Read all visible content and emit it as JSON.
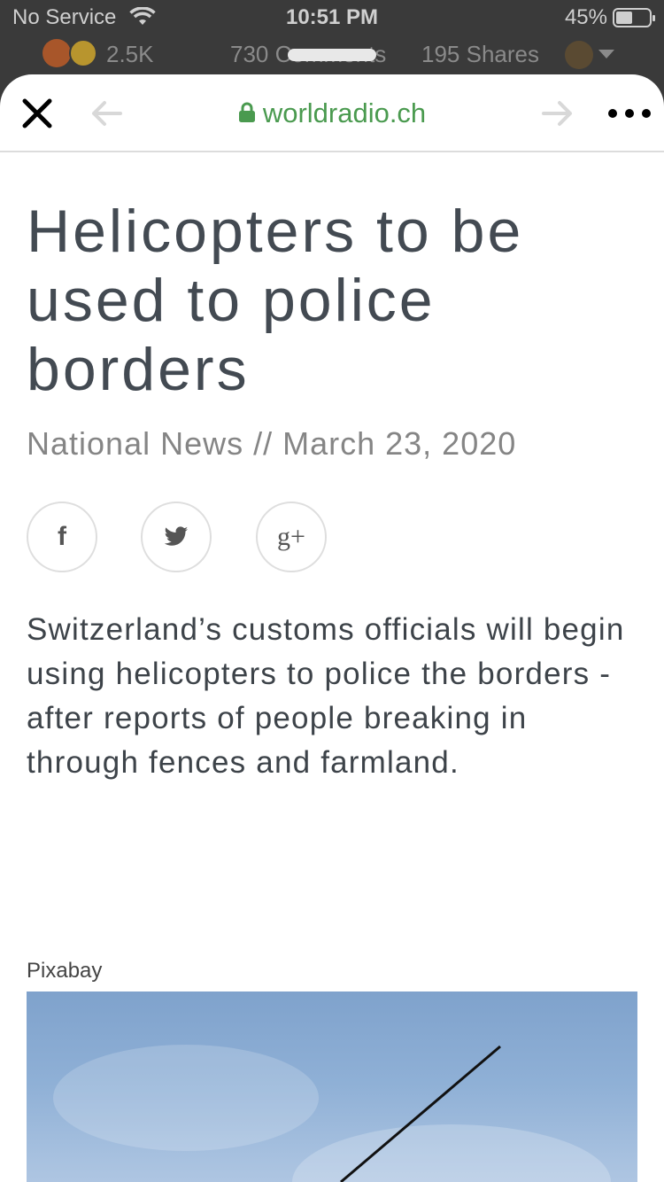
{
  "status_bar": {
    "carrier": "No Service",
    "time": "10:51 PM",
    "battery_pct": "45%"
  },
  "background_post": {
    "reaction_count": "2.5K",
    "comments": "730 Comments",
    "shares": "195 Shares"
  },
  "browser": {
    "url": "worldradio.ch"
  },
  "article": {
    "title": "Helicopters to be used to police borders",
    "meta": "National News // March 23, 2020",
    "lede": "Switzerland’s customs officials will begin using helicopters to police the borders - after reports of people breaking in through fences and farmland.",
    "image_credit": "Pixabay"
  },
  "share_buttons": [
    {
      "icon": "facebook-icon",
      "glyph": "f"
    },
    {
      "icon": "twitter-icon"
    },
    {
      "icon": "google-plus-icon",
      "glyph": "g+"
    }
  ],
  "colors": {
    "url_green": "#4a9a4f",
    "title": "#434a52",
    "meta": "#858585"
  }
}
